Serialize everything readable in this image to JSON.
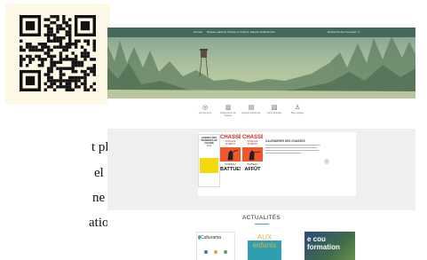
{
  "paragraph_fragments": [
    "t plus",
    "el que",
    "ne est",
    "ations"
  ],
  "qr": {
    "label": "QR code"
  },
  "website": {
    "nav": [
      "Accueil",
      "Réseau national",
      "Chasse en France",
      "Espace Institutionnel",
      "Recherche",
      "Se connecter"
    ],
    "quick_icons": [
      {
        "icon": "compass-icon",
        "glyph": "◎",
        "label": "Vos services"
      },
      {
        "icon": "book-icon",
        "glyph": "▥",
        "label": "Réglements de chasse"
      },
      {
        "icon": "document-icon",
        "glyph": "▤",
        "label": "Espace adhérents"
      },
      {
        "icon": "map-icon",
        "glyph": "▧",
        "label": "Carte fédérale"
      },
      {
        "icon": "user-icon",
        "glyph": "♙",
        "label": "Mon espace"
      }
    ],
    "cards": [
      {
        "title": "AGENDA DES JOURNÉES DE CHASSE",
        "sub": "2024"
      },
      {
        "head": "CHASSE",
        "red": "PASSAGE INTERDIT",
        "big": "BATTUES",
        "small": "PANNEAU"
      },
      {
        "head": "CHASSE",
        "red": "PASSAGE INTERDIT",
        "big": "AFFÛT",
        "small": "PANNEAU"
      }
    ],
    "calendar_title": "CALENDRIER DES CHASSES",
    "news_title": "ACTUALITÉS",
    "news_cards": [
      "Culturama",
      "AUX enfants",
      "e cou formation"
    ]
  },
  "colors": {
    "topbar": "#46675c",
    "accent_red": "#c62828",
    "accent_teal": "#3aa7b7",
    "card_yellow": "#f5d90f",
    "card_orange": "#f2572b"
  }
}
